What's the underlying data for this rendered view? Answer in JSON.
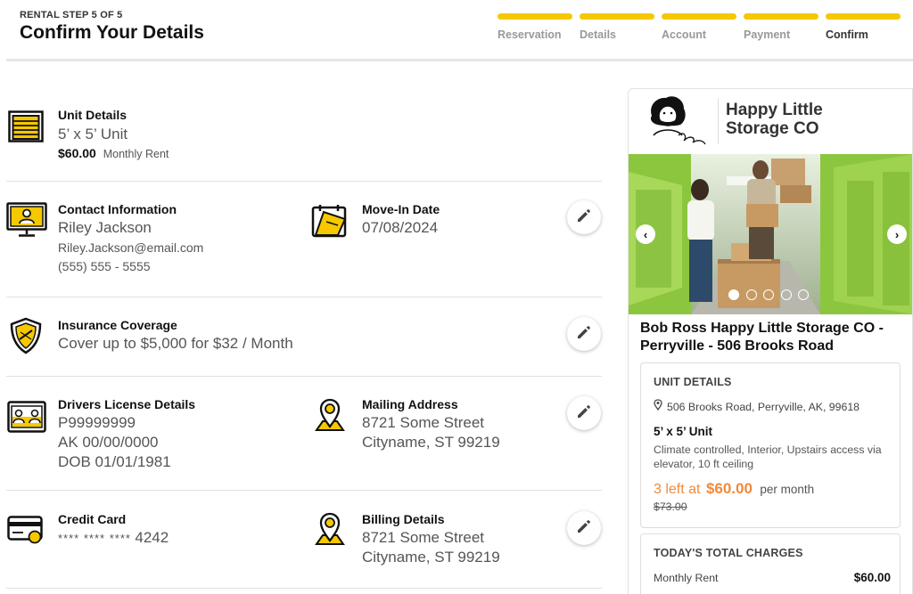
{
  "header": {
    "step_label": "RENTAL STEP 5 OF 5",
    "title": "Confirm Your Details",
    "steps": [
      {
        "label": "Reservation",
        "done": true
      },
      {
        "label": "Details",
        "done": true
      },
      {
        "label": "Account",
        "done": true
      },
      {
        "label": "Payment",
        "done": true
      },
      {
        "label": "Confirm",
        "done": true,
        "current": true
      }
    ],
    "accent_color": "#f5c800"
  },
  "unit": {
    "title": "Unit Details",
    "size": "5’ x 5’ Unit",
    "price": "$60.00",
    "price_label": "Monthly Rent",
    "icon": "storage-unit-icon"
  },
  "contact": {
    "title": "Contact Information",
    "name": "Riley Jackson",
    "email": "Riley.Jackson@email.com",
    "phone": "(555) 555 - 5555",
    "icon": "monitor-person-icon"
  },
  "move_in": {
    "title": "Move-In Date",
    "date": "07/08/2024",
    "icon": "calendar-icon"
  },
  "insurance": {
    "title": "Insurance Coverage",
    "text": "Cover up to $5,000 for $32 / Month",
    "icon": "shield-icon"
  },
  "license": {
    "title": "Drivers License Details",
    "number": "P99999999",
    "state": "AK 00/00/0000",
    "dob": "DOB 01/01/1981",
    "icon": "id-card-icon"
  },
  "mailing": {
    "title": "Mailing Address",
    "line1": "8721 Some Street",
    "line2": "Cityname, ST 99219",
    "icon": "map-pin-icon"
  },
  "card": {
    "title": "Credit Card",
    "masked": "**** **** ****",
    "last4": "4242",
    "icon": "credit-card-icon"
  },
  "billing": {
    "title": "Billing Details",
    "line1": "8721 Some Street",
    "line2": "Cityname, ST 99219",
    "icon": "map-pin-icon"
  },
  "sidebar": {
    "brand_line1": "Happy Little",
    "brand_line2": "Storage CO",
    "facility_name": "Bob Ross Happy Little Storage CO - Perryville - 506 Brooks Road",
    "carousel": {
      "count": 5,
      "active": 1
    },
    "unit_box": {
      "title": "UNIT DETAILS",
      "address": "506 Brooks Road, Perryville, AK, 99618",
      "unit_size": "5’ x 5’ Unit",
      "features": "Climate controlled, Interior, Upstairs access via elevator, 10 ft ceiling",
      "left_text": "3 left at",
      "price": "$60.00",
      "per": "per month",
      "old_price": "$73.00",
      "sale_color": "#f08a3c"
    },
    "charges_box": {
      "title": "TODAY'S TOTAL CHARGES",
      "rent_label": "Monthly Rent",
      "rent_value": "$60.00"
    }
  }
}
